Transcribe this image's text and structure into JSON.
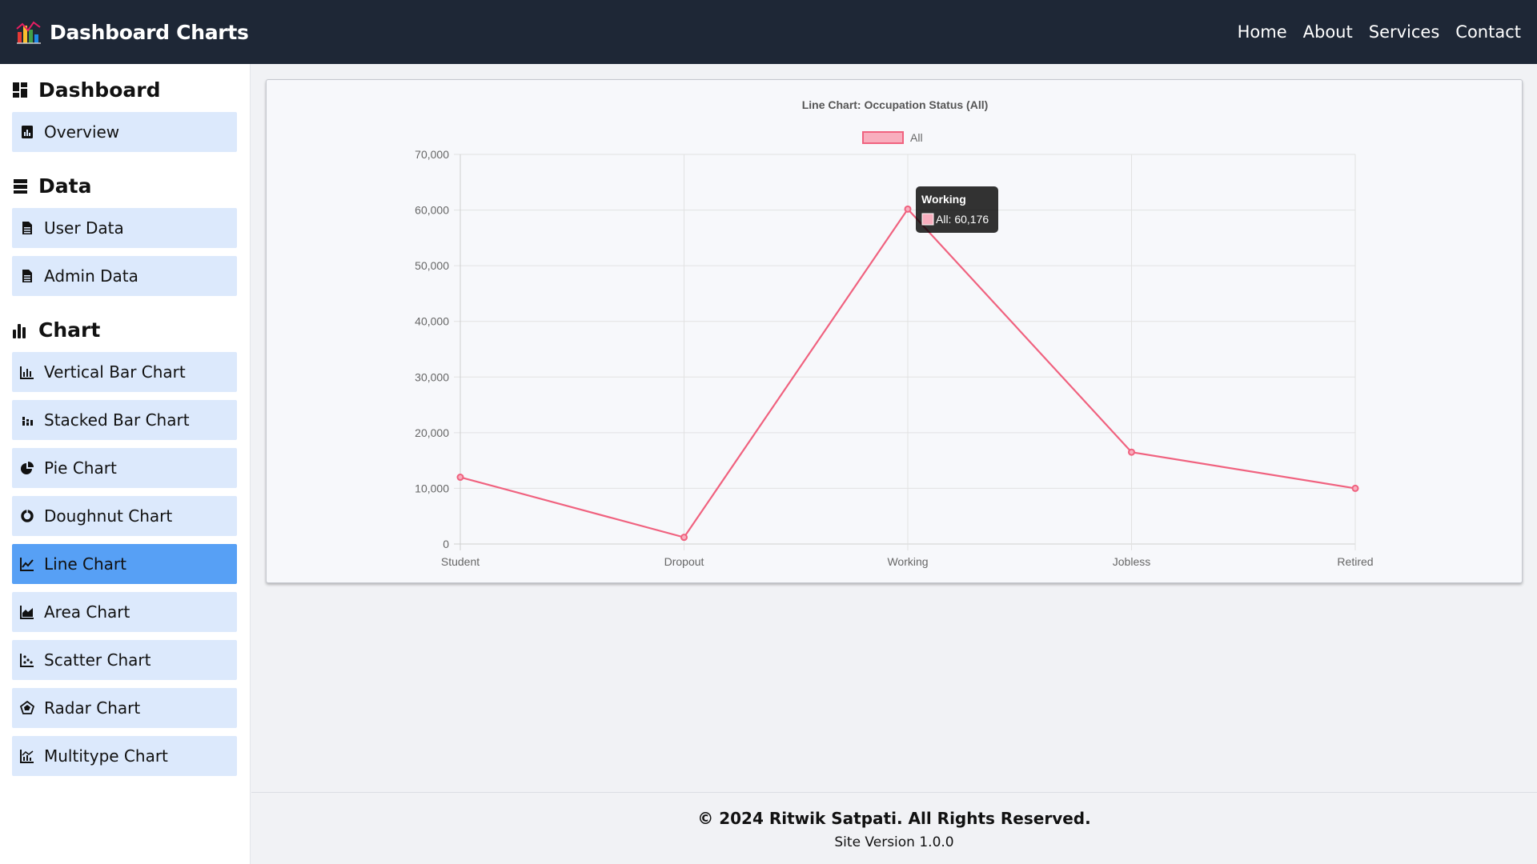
{
  "header": {
    "title": "Dashboard Charts",
    "nav": [
      "Home",
      "About",
      "Services",
      "Contact"
    ]
  },
  "sidebar": {
    "sections": [
      {
        "title": "Dashboard",
        "icon": "dashboard-icon",
        "items": [
          {
            "label": "Overview",
            "icon": "report-icon"
          }
        ]
      },
      {
        "title": "Data",
        "icon": "database-icon",
        "items": [
          {
            "label": "User Data",
            "icon": "sheet-icon"
          },
          {
            "label": "Admin Data",
            "icon": "sheet-icon"
          }
        ]
      },
      {
        "title": "Chart",
        "icon": "bar-chart-icon",
        "items": [
          {
            "label": "Vertical Bar Chart",
            "icon": "vertical-bar-icon"
          },
          {
            "label": "Stacked Bar Chart",
            "icon": "stacked-bar-icon"
          },
          {
            "label": "Pie Chart",
            "icon": "pie-icon"
          },
          {
            "label": "Doughnut Chart",
            "icon": "doughnut-icon"
          },
          {
            "label": "Line Chart",
            "icon": "line-chart-icon",
            "active": true
          },
          {
            "label": "Area Chart",
            "icon": "area-chart-icon"
          },
          {
            "label": "Scatter Chart",
            "icon": "scatter-icon"
          },
          {
            "label": "Radar Chart",
            "icon": "radar-icon"
          },
          {
            "label": "Multitype Chart",
            "icon": "multitype-icon"
          }
        ]
      }
    ]
  },
  "chart_data": {
    "type": "line",
    "title": "Line Chart: Occupation Status (All)",
    "categories": [
      "Student",
      "Dropout",
      "Working",
      "Jobless",
      "Retired"
    ],
    "series": [
      {
        "name": "All",
        "values": [
          12000,
          1200,
          60176,
          16500,
          10000
        ]
      }
    ],
    "ylim": [
      0,
      70000
    ],
    "yticks": [
      "0",
      "10,000",
      "20,000",
      "30,000",
      "40,000",
      "50,000",
      "60,000",
      "70,000"
    ],
    "grid": true,
    "legend": "top",
    "tooltip": {
      "title": "Working",
      "body": "All: 60,176"
    },
    "colors": {
      "line": "#f0627f",
      "fill": "#f8aebe"
    }
  },
  "footer": {
    "copyright": "© 2024 Ritwik Satpati. All Rights Reserved.",
    "version": "Site Version 1.0.0"
  },
  "colors": {
    "header": "#1e2736",
    "item_bg": "#dce9fc",
    "item_active": "#57a0f5"
  }
}
